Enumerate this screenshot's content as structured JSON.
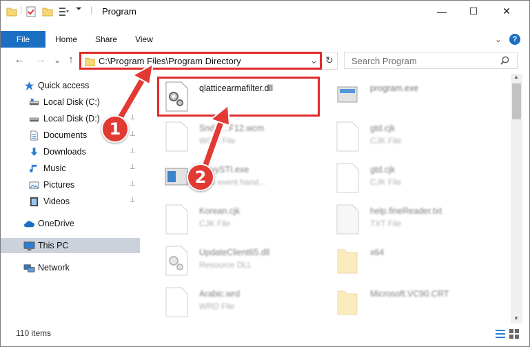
{
  "window": {
    "title": "Program",
    "controls": {
      "minimize": "—",
      "maximize": "☐",
      "close": "✕"
    }
  },
  "ribbon": {
    "tabs": [
      "File",
      "Home",
      "Share",
      "View"
    ],
    "expand": "⌄",
    "help": "?"
  },
  "nav_buttons": {
    "back": "←",
    "forward": "→",
    "recent": "⌄",
    "up": "↑"
  },
  "address": {
    "path": "C:\\Program Files\\Program Directory",
    "dropdown": "⌄",
    "refresh": "↻"
  },
  "search": {
    "placeholder": "Search Program",
    "icon": "search-icon"
  },
  "nav_pane": {
    "items": [
      {
        "label": "Quick access",
        "icon": "star-icon"
      },
      {
        "label": "Local Disk (C:)",
        "icon": "drive-icon",
        "pinned": true
      },
      {
        "label": "Local Disk (D:)",
        "icon": "drive-icon",
        "pinned": true
      },
      {
        "label": "Documents",
        "icon": "document-icon",
        "pinned": true
      },
      {
        "label": "Downloads",
        "icon": "download-icon",
        "pinned": true
      },
      {
        "label": "Music",
        "icon": "music-icon",
        "pinned": true
      },
      {
        "label": "Pictures",
        "icon": "picture-icon",
        "pinned": true
      },
      {
        "label": "Videos",
        "icon": "video-icon",
        "pinned": true
      },
      {
        "label": "OneDrive",
        "icon": "cloud-icon"
      },
      {
        "label": "This PC",
        "icon": "computer-icon",
        "selected": true
      },
      {
        "label": "Network",
        "icon": "network-icon"
      }
    ],
    "pin_glyph": "📌"
  },
  "files": [
    {
      "name": "qlatticearmafilter.dll",
      "type": "",
      "icon": "dll-gear-icon",
      "highlighted": true
    },
    {
      "name": "program.exe",
      "type": "",
      "icon": "exe-icon"
    },
    {
      "name": "SndTr...F12.wcm",
      "type": "WCM File",
      "icon": "file-icon"
    },
    {
      "name": "gtd.cjk",
      "type": "CJK File",
      "icon": "file-icon"
    },
    {
      "name": "...vyySTI.exe",
      "type": "...ob event hand...",
      "icon": "exe-icon"
    },
    {
      "name": "gtd.cjk",
      "type": "CJK File",
      "icon": "file-icon"
    },
    {
      "name": "Korean.cjk",
      "type": "CJK File",
      "icon": "file-icon"
    },
    {
      "name": "help.fineReader.txt",
      "type": "TXT File",
      "icon": "file-icon"
    },
    {
      "name": "UpdateClient65.dll",
      "type": "Resource DLL",
      "icon": "dll-gear-icon"
    },
    {
      "name": "x64",
      "type": "",
      "icon": "folder-icon"
    },
    {
      "name": "Arabic.wrd",
      "type": "WRD File",
      "icon": "file-icon"
    },
    {
      "name": "Microsoft.VC90.CRT",
      "type": "",
      "icon": "folder-icon"
    }
  ],
  "callouts": [
    "1",
    "2"
  ],
  "status": {
    "count": "110 items"
  },
  "colors": {
    "accent": "#1a6fc2",
    "highlight_red": "#e02a2a",
    "selected_bg": "#ccd2db"
  }
}
